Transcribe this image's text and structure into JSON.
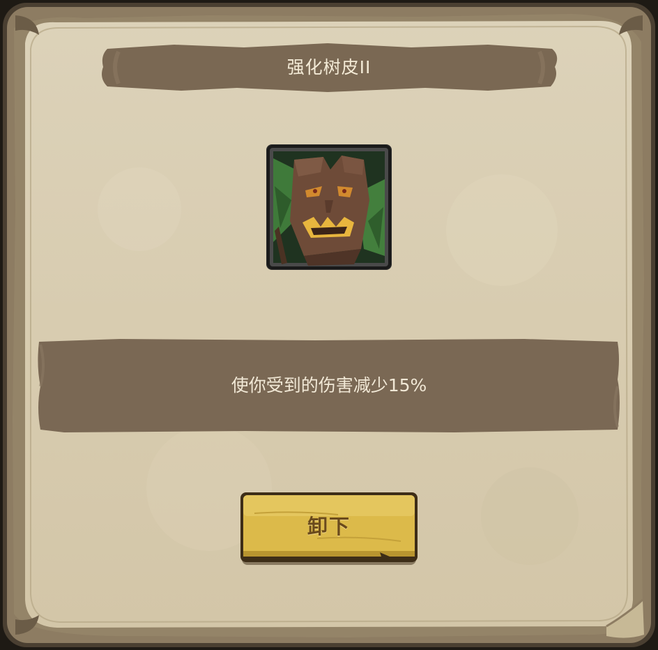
{
  "dialog": {
    "title": "强化树皮II",
    "description": "使你受到的伤害减少15%",
    "unequip_label": "卸下"
  },
  "skill_icon": {
    "name": "treant-face-icon"
  },
  "colors": {
    "parchment": "#d9ceb4",
    "frame_brown": "#8c7c62",
    "banner_brown": "#7a6853",
    "title_text": "#f3ead6",
    "button_gold": "#d9b545",
    "button_text": "#6a4a1c"
  }
}
